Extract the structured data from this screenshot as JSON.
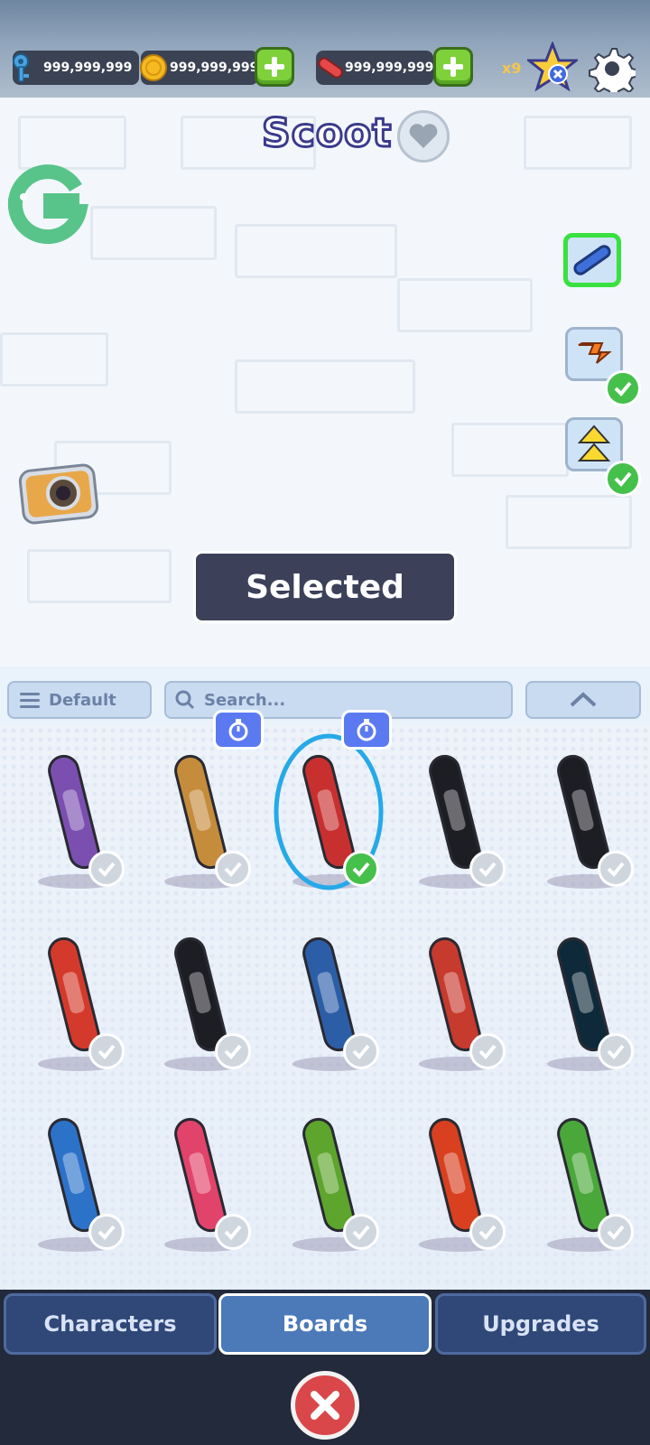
{
  "currencies": {
    "keys": "999,999,999",
    "coins": "999,999,999",
    "boards": "999,999,999",
    "multiplier": "x9"
  },
  "character": {
    "name": "Scoot"
  },
  "actions": {
    "selected_label": "Selected"
  },
  "filters": {
    "sort_label": "Default",
    "search_placeholder": "Search..."
  },
  "boards": [
    {
      "color": "#7b4fb0",
      "owned": true,
      "timed": false
    },
    {
      "color": "#c58c3c",
      "owned": true,
      "timed": true
    },
    {
      "color": "#c8302f",
      "owned": true,
      "timed": true,
      "selected": true
    },
    {
      "color": "#1d1d24",
      "owned": true,
      "timed": false
    },
    {
      "color": "#1d1d24",
      "owned": true,
      "timed": false
    },
    {
      "color": "#d43a2b",
      "owned": true,
      "timed": false
    },
    {
      "color": "#1d1d24",
      "owned": true,
      "timed": false
    },
    {
      "color": "#2c5ea8",
      "owned": true,
      "timed": false
    },
    {
      "color": "#c73a2e",
      "owned": true,
      "timed": false
    },
    {
      "color": "#0e2a3a",
      "owned": true,
      "timed": false
    },
    {
      "color": "#2c72c9",
      "owned": true,
      "timed": false
    },
    {
      "color": "#e2436a",
      "owned": true,
      "timed": false
    },
    {
      "color": "#5da52c",
      "owned": true,
      "timed": false
    },
    {
      "color": "#d8401f",
      "owned": true,
      "timed": false
    },
    {
      "color": "#4aa83a",
      "owned": true,
      "timed": false
    }
  ],
  "tabs": [
    {
      "label": "Characters",
      "active": false
    },
    {
      "label": "Boards",
      "active": true
    },
    {
      "label": "Upgrades",
      "active": false
    }
  ],
  "colors": {
    "accent_green": "#7ed13a",
    "selected_check": "#45c04b",
    "title_stroke": "#3b3a8c",
    "tab_active": "#4c79b8"
  }
}
